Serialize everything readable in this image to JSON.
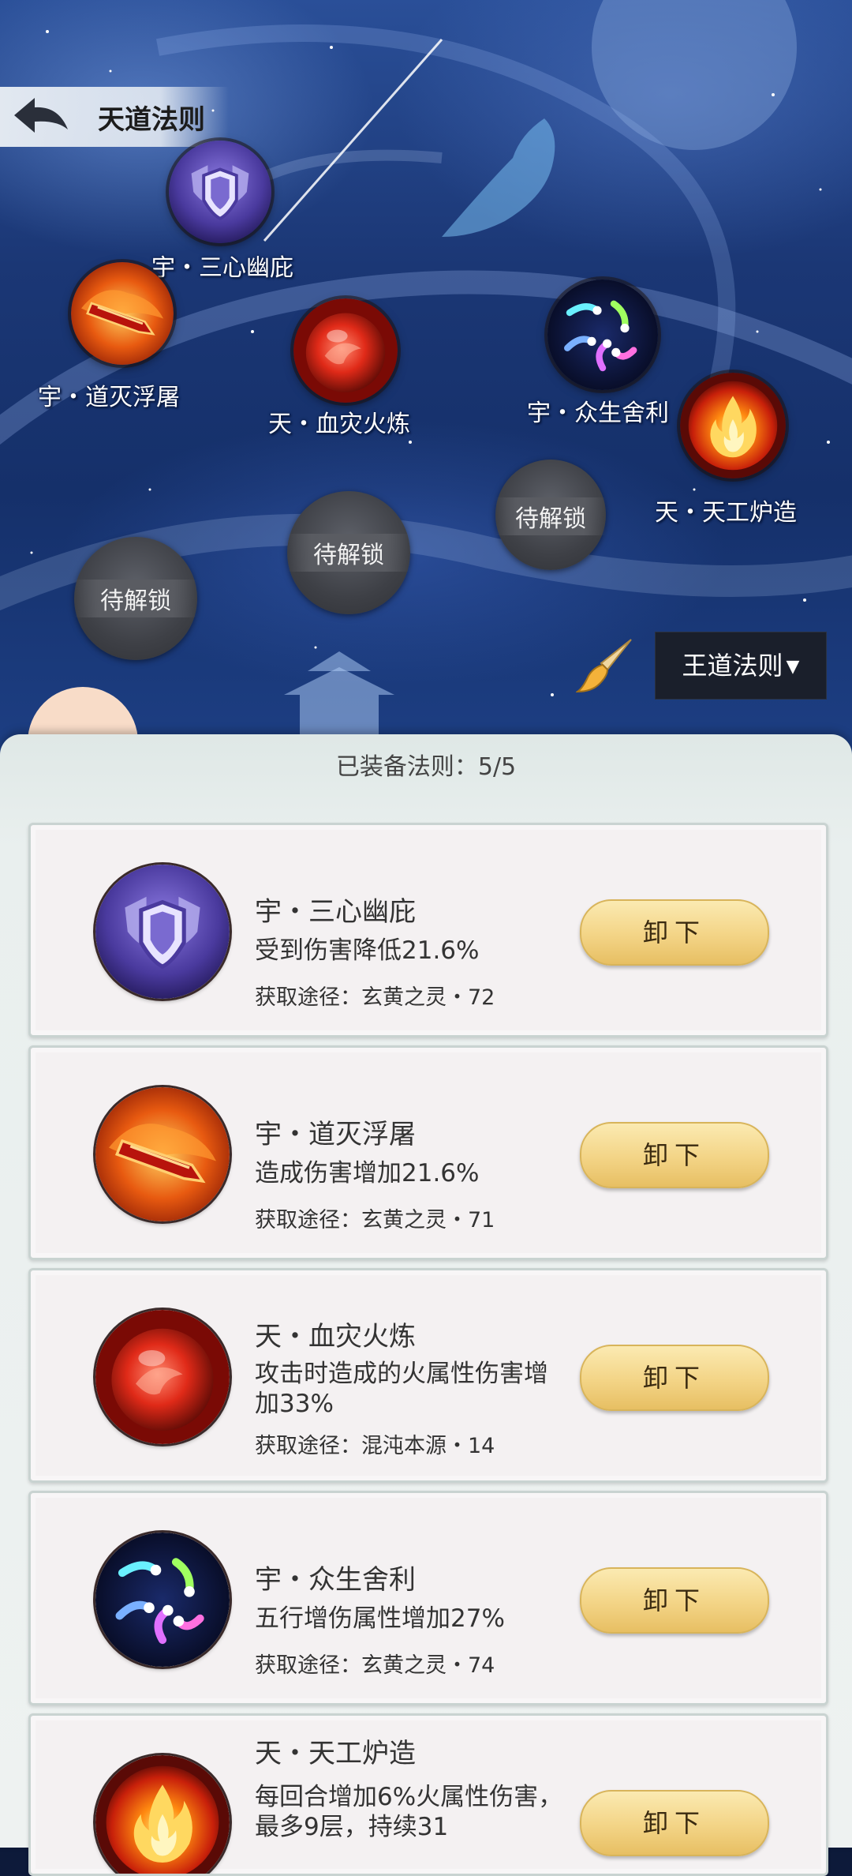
{
  "header": {
    "title": "天道法则"
  },
  "map": {
    "nodes": [
      {
        "name": "宇・三心幽庇",
        "icon": "shield-icon"
      },
      {
        "name": "宇・道灭浮屠",
        "icon": "flame-sword-icon"
      },
      {
        "name": "天・血灾火炼",
        "icon": "fire-orb-icon"
      },
      {
        "name": "宇・众生舍利",
        "icon": "comet-icon"
      },
      {
        "name": "天・天工炉造",
        "icon": "fire-icon"
      }
    ],
    "locked": [
      "待解锁",
      "待解锁",
      "待解锁"
    ],
    "dropdown": {
      "label": "王道法则",
      "arrow": "▼"
    }
  },
  "panel": {
    "header_label": "已装备法则：",
    "header_value": "5/5",
    "button_label": "卸下",
    "cards": [
      {
        "name": "宇・三心幽庇",
        "desc": "受到伤害降低21.6%",
        "source": "获取途径：玄黄之灵・72",
        "icon": "shield-icon"
      },
      {
        "name": "宇・道灭浮屠",
        "desc": "造成伤害增加21.6%",
        "source": "获取途径：玄黄之灵・71",
        "icon": "flame-sword-icon"
      },
      {
        "name": "天・血灾火炼",
        "desc": "攻击时造成的火属性伤害增加33%",
        "source": "获取途径：混沌本源・14",
        "icon": "fire-orb-icon"
      },
      {
        "name": "宇・众生舍利",
        "desc": "五行增伤属性增加27%",
        "source": "获取途径：玄黄之灵・74",
        "icon": "comet-icon"
      },
      {
        "name": "天・天工炉造",
        "desc": "每回合增加6%火属性伤害，最多9层，持续31",
        "source": "",
        "icon": "fire-icon"
      }
    ]
  },
  "colors": {
    "map_bg": "#1b3775",
    "panel_bg": "#eef2f1",
    "button_gold": "#f3d486",
    "dropdown_bg": "#1a1f2b"
  }
}
